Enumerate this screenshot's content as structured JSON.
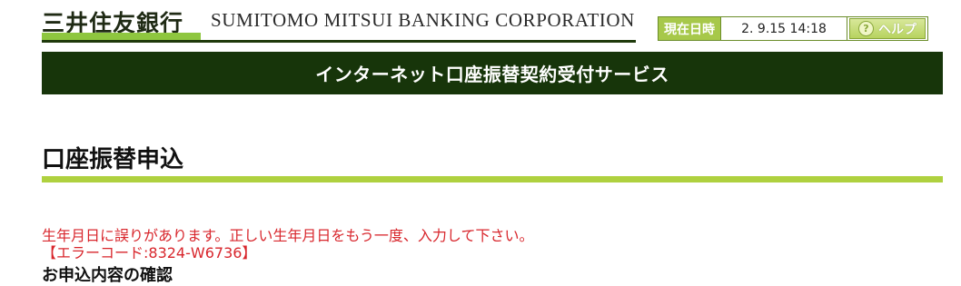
{
  "header": {
    "logo_jp": "三井住友銀行",
    "logo_en": "SUMITOMO MITSUI BANKING CORPORATION",
    "datetime_label": "現在日時",
    "datetime_value": "2. 9.15 14:18",
    "help_label": "ヘルプ",
    "help_icon_glyph": "?"
  },
  "banner": {
    "title": "インターネット口座振替契約受付サービス"
  },
  "main": {
    "page_title": "口座振替申込",
    "error_message": "生年月日に誤りがあります。正しい生年月日をもう一度、入力して下さい。",
    "error_code": "【エラーコード:8324-W6736】",
    "section_heading": "お申込内容の確認"
  },
  "colors": {
    "brand_dark_green": "#17350a",
    "brand_light_green": "#afd13f",
    "error_red": "#d8262c"
  }
}
